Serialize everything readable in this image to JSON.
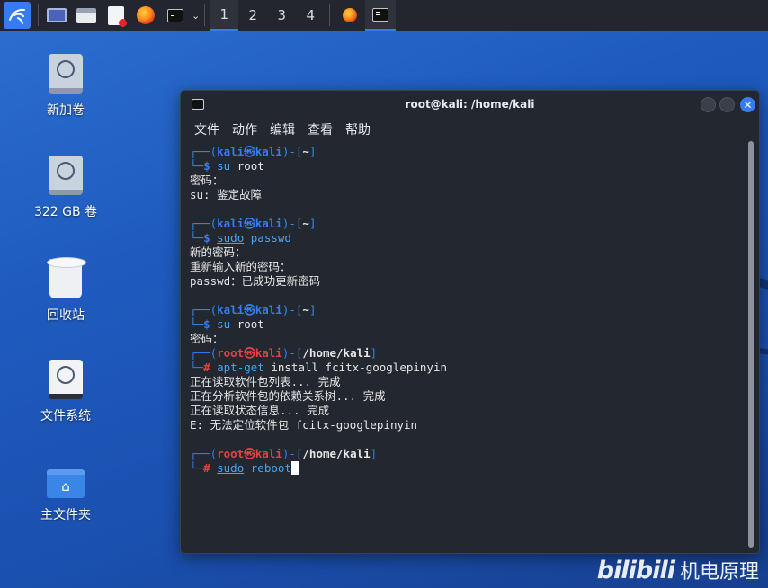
{
  "taskbar": {
    "workspaces": [
      "1",
      "2",
      "3",
      "4"
    ],
    "active_workspace_index": 0
  },
  "desktop": {
    "icons": [
      {
        "label": "新加卷",
        "icon": "drive-icon"
      },
      {
        "label": "322 GB 卷",
        "icon": "drive-icon"
      },
      {
        "label": "回收站",
        "icon": "trash-icon"
      },
      {
        "label": "文件系统",
        "icon": "filesystem-drive-icon"
      },
      {
        "label": "主文件夹",
        "icon": "home-folder-icon"
      }
    ]
  },
  "terminal": {
    "title": "root@kali: /home/kali",
    "close_glyph": "✕",
    "menu": [
      "文件",
      "动作",
      "编辑",
      "查看",
      "帮助"
    ],
    "lines": [
      [
        {
          "t": "┌──(",
          "c": "box"
        },
        {
          "t": "kali㉿kali",
          "c": "user"
        },
        {
          "t": ")-[",
          "c": "box"
        },
        {
          "t": "~",
          "c": "path"
        },
        {
          "t": "]",
          "c": "box"
        }
      ],
      [
        {
          "t": "└─",
          "c": "box"
        },
        {
          "t": "$ ",
          "c": "user"
        },
        {
          "t": "su",
          "c": "cmd"
        },
        {
          "t": " root",
          "c": ""
        }
      ],
      [
        {
          "t": "密码：",
          "c": ""
        }
      ],
      [
        {
          "t": "su: 鉴定故障",
          "c": ""
        }
      ],
      [],
      [
        {
          "t": "┌──(",
          "c": "box"
        },
        {
          "t": "kali㉿kali",
          "c": "user"
        },
        {
          "t": ")-[",
          "c": "box"
        },
        {
          "t": "~",
          "c": "path"
        },
        {
          "t": "]",
          "c": "box"
        }
      ],
      [
        {
          "t": "└─",
          "c": "box"
        },
        {
          "t": "$ ",
          "c": "user"
        },
        {
          "t": "sudo",
          "c": "sudo"
        },
        {
          "t": " ",
          "c": ""
        },
        {
          "t": "passwd",
          "c": "cmd"
        }
      ],
      [
        {
          "t": "新的密码：",
          "c": ""
        }
      ],
      [
        {
          "t": "重新输入新的密码：",
          "c": ""
        }
      ],
      [
        {
          "t": "passwd：已成功更新密码",
          "c": ""
        }
      ],
      [],
      [
        {
          "t": "┌──(",
          "c": "box"
        },
        {
          "t": "kali㉿kali",
          "c": "user"
        },
        {
          "t": ")-[",
          "c": "box"
        },
        {
          "t": "~",
          "c": "path"
        },
        {
          "t": "]",
          "c": "box"
        }
      ],
      [
        {
          "t": "└─",
          "c": "box"
        },
        {
          "t": "$ ",
          "c": "user"
        },
        {
          "t": "su",
          "c": "cmd"
        },
        {
          "t": " root",
          "c": ""
        }
      ],
      [
        {
          "t": "密码：",
          "c": ""
        }
      ],
      [
        {
          "t": "┌──(",
          "c": "boxr"
        },
        {
          "t": "root㉿kali",
          "c": "root"
        },
        {
          "t": ")-[",
          "c": "boxr"
        },
        {
          "t": "/home/kali",
          "c": "path"
        },
        {
          "t": "]",
          "c": "boxr"
        }
      ],
      [
        {
          "t": "└─",
          "c": "boxr"
        },
        {
          "t": "# ",
          "c": "root"
        },
        {
          "t": "apt-get",
          "c": "cmd"
        },
        {
          "t": " install fcitx-googlepinyin",
          "c": ""
        }
      ],
      [
        {
          "t": "正在读取软件包列表... 完成",
          "c": ""
        }
      ],
      [
        {
          "t": "正在分析软件包的依赖关系树... 完成",
          "c": ""
        }
      ],
      [
        {
          "t": "正在读取状态信息... 完成",
          "c": ""
        }
      ],
      [
        {
          "t": "E: 无法定位软件包 fcitx-googlepinyin",
          "c": ""
        }
      ],
      [],
      [
        {
          "t": "┌──(",
          "c": "boxr"
        },
        {
          "t": "root㉿kali",
          "c": "root"
        },
        {
          "t": ")-[",
          "c": "boxr"
        },
        {
          "t": "/home/kali",
          "c": "path"
        },
        {
          "t": "]",
          "c": "boxr"
        }
      ],
      [
        {
          "t": "└─",
          "c": "boxr"
        },
        {
          "t": "# ",
          "c": "root"
        },
        {
          "t": "sudo",
          "c": "sudo"
        },
        {
          "t": " ",
          "c": ""
        },
        {
          "t": "reboot",
          "c": "cmd"
        },
        {
          "t": "",
          "c": "cursor"
        }
      ]
    ]
  },
  "watermark": {
    "logo": "bilibili",
    "text": "机电原理"
  },
  "colors": {
    "accent": "#367bf0",
    "terminal_bg": "#23272f",
    "root_prompt": "#e34242"
  }
}
